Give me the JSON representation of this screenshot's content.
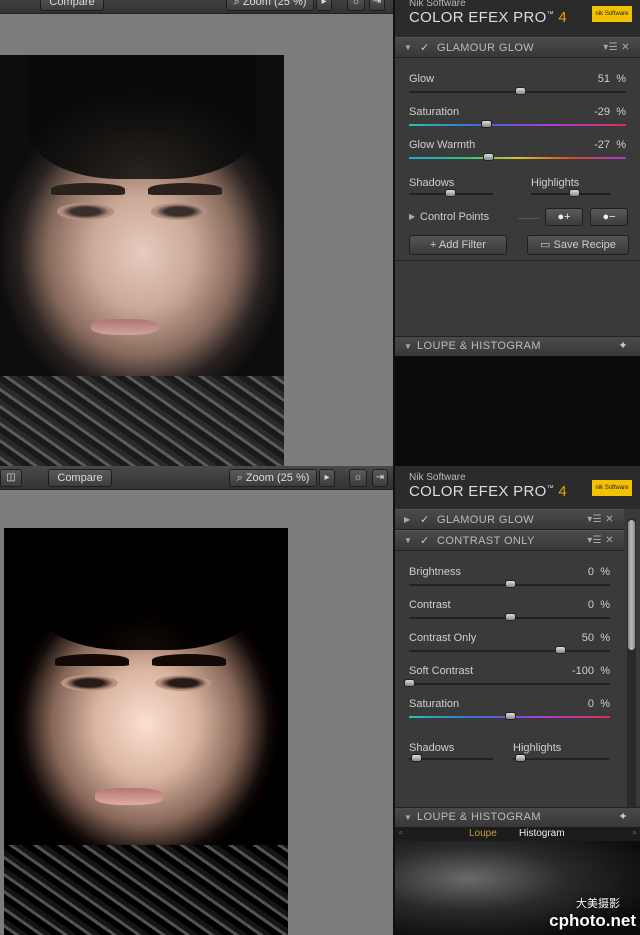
{
  "top_view": {
    "toolbar": {
      "compare_label": "Compare",
      "zoom_label": "Zoom (25 %)",
      "zoom_icon": "magnifier-icon"
    },
    "panel": {
      "brand_company": "Nik Software",
      "brand_product": "COLOR EFEX PRO",
      "brand_tm": "™",
      "brand_version": "4",
      "logo_text": "nik Software",
      "filter": {
        "name": "GLAMOUR GLOW",
        "sliders": [
          {
            "label": "Glow",
            "value": "51",
            "unit": "%",
            "level": 0.51
          },
          {
            "label": "Saturation",
            "value": "-29",
            "unit": "%",
            "level": 0.355
          },
          {
            "label": "Glow Warmth",
            "value": "-27",
            "unit": "%",
            "level": 0.365
          }
        ],
        "shadows_label": "Shadows",
        "highlights_label": "Highlights",
        "control_points_label": "Control Points",
        "add_cp_label": "●+",
        "remove_cp_label": "●−"
      },
      "add_filter_label": "+ Add Filter",
      "save_recipe_label": "Save Recipe",
      "loupe_label": "LOUPE & HISTOGRAM"
    }
  },
  "bottom_view": {
    "toolbar": {
      "compare_label": "Compare",
      "zoom_label": "Zoom (25 %)"
    },
    "panel": {
      "brand_company": "Nik Software",
      "brand_product": "COLOR EFEX PRO",
      "brand_tm": "™",
      "brand_version": "4",
      "logo_text": "nik Software",
      "filter_collapsed": {
        "name": "GLAMOUR GLOW"
      },
      "filter": {
        "name": "CONTRAST ONLY",
        "sliders": [
          {
            "label": "Brightness",
            "value": "0",
            "unit": "%",
            "level": 0.5
          },
          {
            "label": "Contrast",
            "value": "0",
            "unit": "%",
            "level": 0.5
          },
          {
            "label": "Contrast Only",
            "value": "50",
            "unit": "%",
            "level": 0.75
          },
          {
            "label": "Soft Contrast",
            "value": "-100",
            "unit": "%",
            "level": 0.0
          },
          {
            "label": "Saturation",
            "value": "0",
            "unit": "%",
            "level": 0.5
          }
        ],
        "shadows_label": "Shadows",
        "highlights_label": "Highlights"
      },
      "loupe_label": "LOUPE & HISTOGRAM",
      "loupe_tab": "Loupe",
      "histogram_tab": "Histogram"
    }
  },
  "watermark": {
    "site": "cphoto.net",
    "cn": "大美摄影"
  },
  "colors": {
    "accent_orange": "#f0a000",
    "panel_bg": "#3a3a3a",
    "logo_yellow": "#f2c200"
  }
}
